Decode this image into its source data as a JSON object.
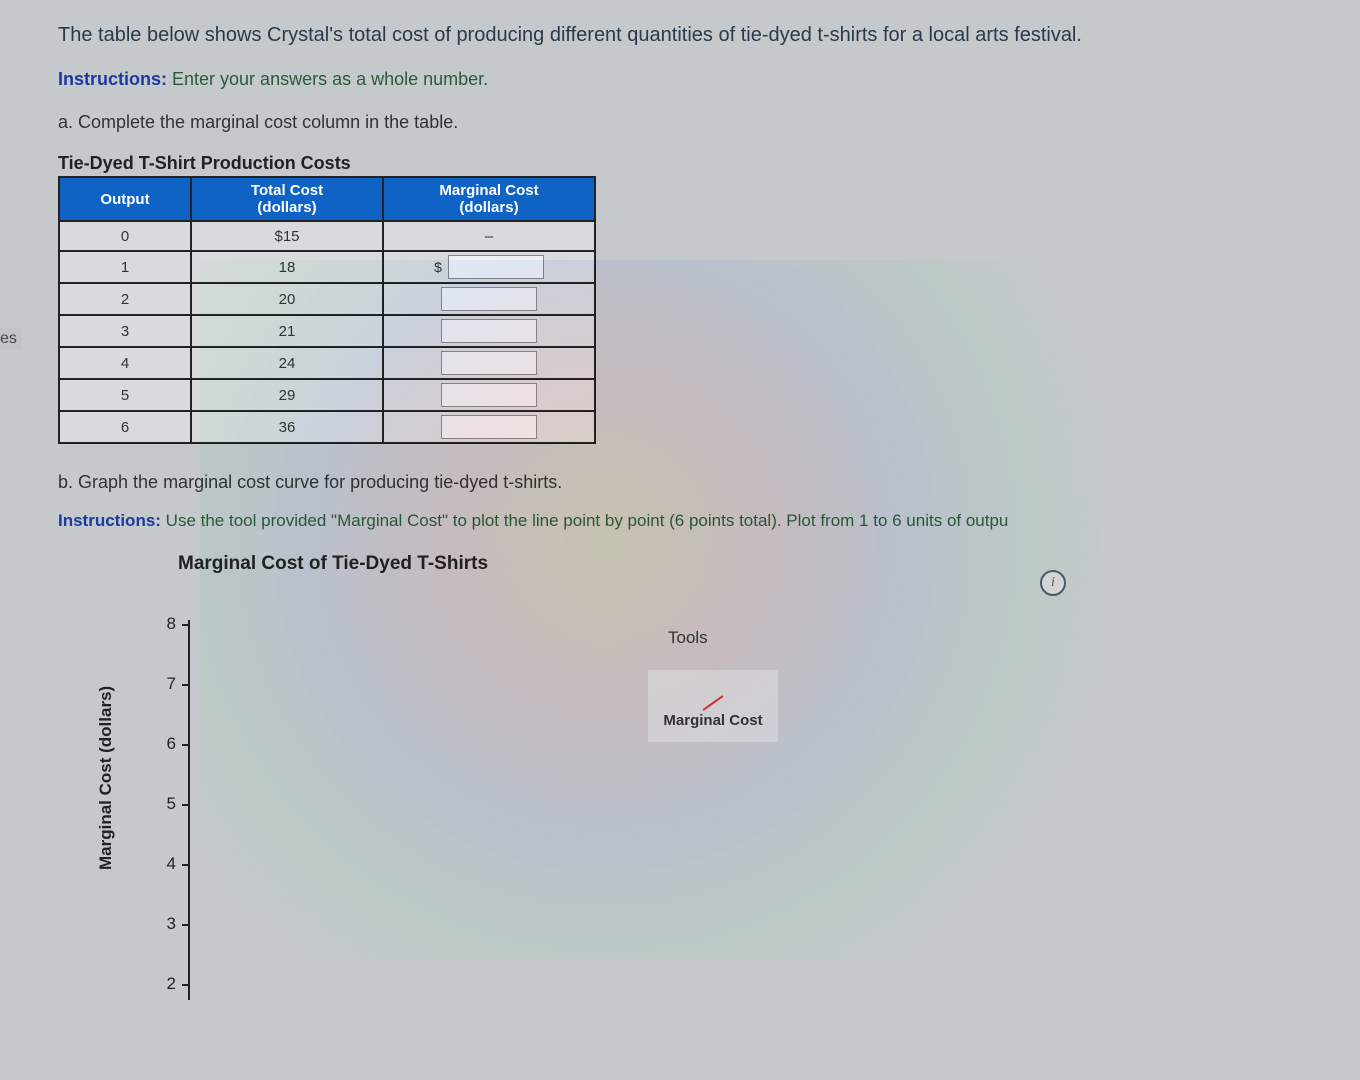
{
  "left_tab": "es",
  "intro": "The table below shows Crystal's total cost of producing different quantities of tie-dyed t-shirts for a local arts festival.",
  "instructions_label": "Instructions:",
  "instructions_text": " Enter your answers as a whole number.",
  "part_a": "a. Complete the marginal cost column in the table.",
  "table_title": "Tie-Dyed T-Shirt Production Costs",
  "table": {
    "headers": {
      "output": "Output",
      "total": "Total Cost\n(dollars)",
      "marginal": "Marginal Cost\n(dollars)"
    },
    "rows": [
      {
        "output": "0",
        "total": "$15",
        "marginal_display": "–",
        "has_input": false
      },
      {
        "output": "1",
        "total": "18",
        "has_input": true,
        "show_dollar": true
      },
      {
        "output": "2",
        "total": "20",
        "has_input": true,
        "show_dollar": false
      },
      {
        "output": "3",
        "total": "21",
        "has_input": true,
        "show_dollar": false
      },
      {
        "output": "4",
        "total": "24",
        "has_input": true,
        "show_dollar": false
      },
      {
        "output": "5",
        "total": "29",
        "has_input": true,
        "show_dollar": false
      },
      {
        "output": "6",
        "total": "36",
        "has_input": true,
        "show_dollar": false
      }
    ]
  },
  "part_b": "b. Graph the marginal cost curve for producing tie-dyed t-shirts.",
  "instructions2_label": "Instructions:",
  "instructions2_text": " Use the tool provided \"Marginal Cost\" to plot the line point by point (6 points total). Plot from 1 to 6 units of outpu",
  "chart_title": "Marginal Cost of Tie-Dyed T-Shirts",
  "tools_label": "Tools",
  "tool_name": "Marginal Cost",
  "info_glyph": "i",
  "chart_data": {
    "type": "line",
    "title": "Marginal Cost of Tie-Dyed T-Shirts",
    "xlabel": "",
    "ylabel": "Marginal Cost (dollars)",
    "x": [],
    "y_ticks": [
      8,
      7,
      6,
      5,
      4,
      3,
      2
    ],
    "ylim": [
      1,
      8
    ],
    "series": [
      {
        "name": "Marginal Cost",
        "values": []
      }
    ]
  }
}
